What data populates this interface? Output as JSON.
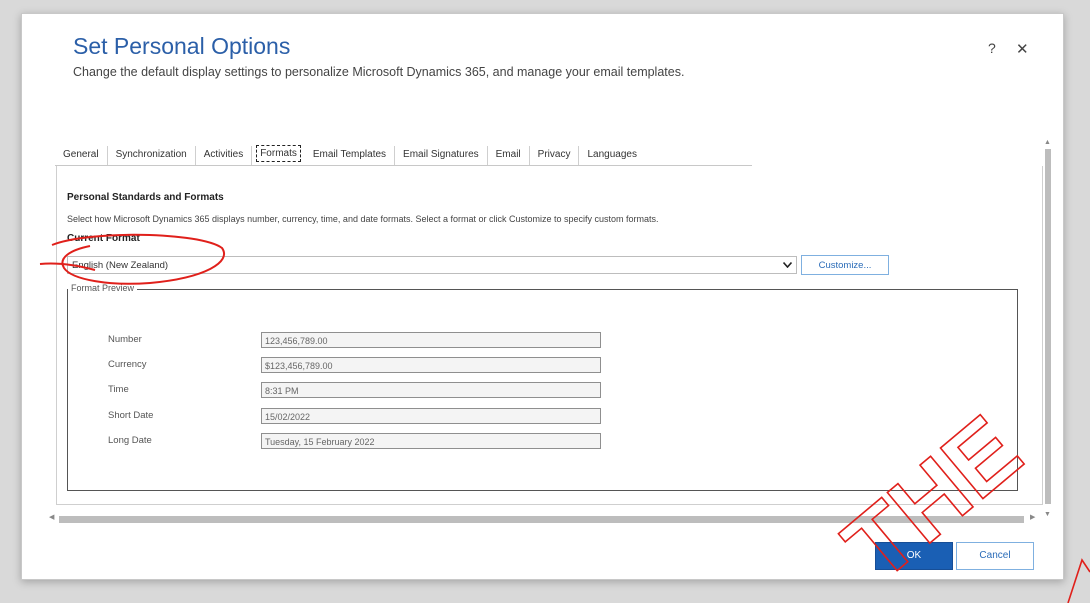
{
  "dialog": {
    "title": "Set Personal Options",
    "subtitle": "Change the default display settings to personalize Microsoft Dynamics 365, and manage your email templates.",
    "help_glyph": "?",
    "close_glyph": "✕"
  },
  "tabs": [
    {
      "label": "General"
    },
    {
      "label": "Synchronization"
    },
    {
      "label": "Activities"
    },
    {
      "label": "Formats",
      "active": true
    },
    {
      "label": "Email Templates"
    },
    {
      "label": "Email Signatures"
    },
    {
      "label": "Email"
    },
    {
      "label": "Privacy"
    },
    {
      "label": "Languages"
    }
  ],
  "formats": {
    "section_title": "Personal Standards and Formats",
    "description": "Select how Microsoft Dynamics 365 displays number, currency, time, and date formats. Select a format or click Customize to specify custom formats.",
    "current_format_label": "Current Format",
    "current_format_value": "English (New Zealand)",
    "customize_label": "Customize...",
    "preview_legend": "Format Preview",
    "preview": [
      {
        "label": "Number",
        "value": "123,456,789.00"
      },
      {
        "label": "Currency",
        "value": "$123,456,789.00"
      },
      {
        "label": "Time",
        "value": "8:31 PM"
      },
      {
        "label": "Short Date",
        "value": "15/02/2022"
      },
      {
        "label": "Long Date",
        "value": "Tuesday, 15 February 2022"
      }
    ]
  },
  "footer": {
    "ok_label": "OK",
    "cancel_label": "Cancel"
  },
  "watermark": {
    "text": "THE"
  },
  "colors": {
    "title": "#2b5fa8",
    "primary_button": "#1a5fb4",
    "annotation": "#e0201b"
  },
  "icons": [
    "help-icon",
    "close-icon",
    "chevron-down-icon"
  ]
}
